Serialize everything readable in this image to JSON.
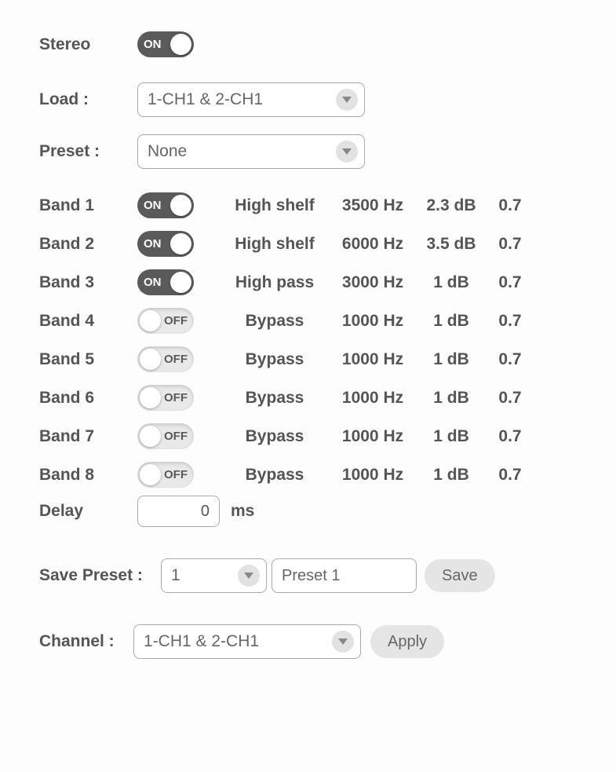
{
  "stereo": {
    "label": "Stereo",
    "state": "ON",
    "on": true
  },
  "load": {
    "label": "Load :",
    "value": "1-CH1 & 2-CH1"
  },
  "preset": {
    "label": "Preset :",
    "value": "None"
  },
  "toggleText": {
    "on": "ON",
    "off": "OFF"
  },
  "bands": [
    {
      "label": "Band 1",
      "on": true,
      "type": "High shelf",
      "freq": "3500 Hz",
      "gain": "2.3 dB",
      "q": "0.7"
    },
    {
      "label": "Band 2",
      "on": true,
      "type": "High shelf",
      "freq": "6000 Hz",
      "gain": "3.5 dB",
      "q": "0.7"
    },
    {
      "label": "Band 3",
      "on": true,
      "type": "High pass",
      "freq": "3000 Hz",
      "gain": "1 dB",
      "q": "0.7"
    },
    {
      "label": "Band 4",
      "on": false,
      "type": "Bypass",
      "freq": "1000 Hz",
      "gain": "1 dB",
      "q": "0.7"
    },
    {
      "label": "Band 5",
      "on": false,
      "type": "Bypass",
      "freq": "1000 Hz",
      "gain": "1 dB",
      "q": "0.7"
    },
    {
      "label": "Band 6",
      "on": false,
      "type": "Bypass",
      "freq": "1000 Hz",
      "gain": "1 dB",
      "q": "0.7"
    },
    {
      "label": "Band 7",
      "on": false,
      "type": "Bypass",
      "freq": "1000 Hz",
      "gain": "1 dB",
      "q": "0.7"
    },
    {
      "label": "Band 8",
      "on": false,
      "type": "Bypass",
      "freq": "1000 Hz",
      "gain": "1 dB",
      "q": "0.7"
    }
  ],
  "delay": {
    "label": "Delay",
    "value": "0",
    "unit": "ms"
  },
  "savePreset": {
    "label": "Save Preset :",
    "slot": "1",
    "name": "Preset 1",
    "button": "Save"
  },
  "channel": {
    "label": "Channel :",
    "value": "1-CH1 & 2-CH1",
    "button": "Apply"
  }
}
